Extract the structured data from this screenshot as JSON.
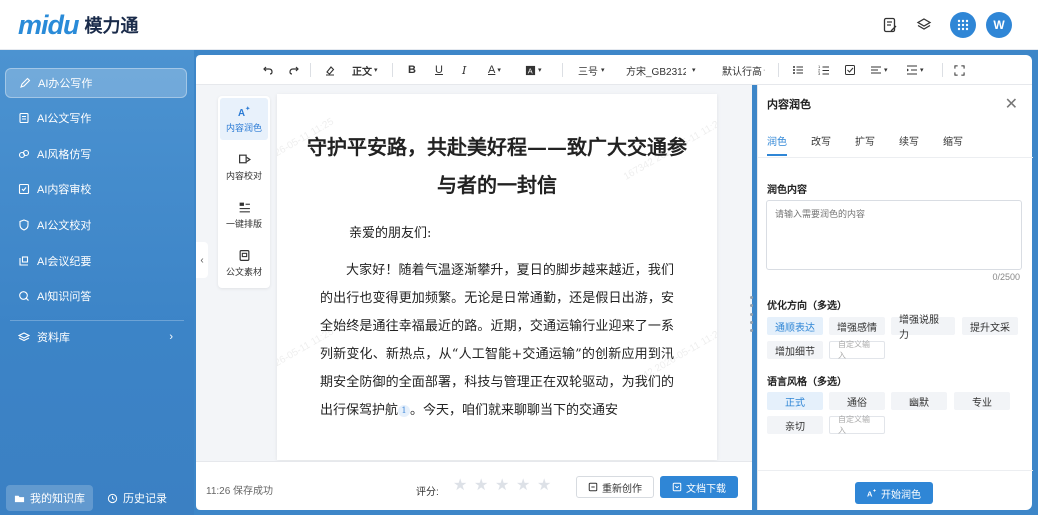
{
  "brand": {
    "logo_mark": "midu",
    "logo_text": "模力通"
  },
  "header": {
    "icons": [
      "document-edit-icon",
      "layers-icon",
      "apps-grid-icon"
    ],
    "avatar_initial": "W"
  },
  "sidebar": {
    "items": [
      {
        "label": "AI办公写作",
        "icon": "pen-icon",
        "active": true
      },
      {
        "label": "AI公文写作",
        "icon": "document-icon",
        "active": false
      },
      {
        "label": "AI风格仿写",
        "icon": "style-icon",
        "active": false
      },
      {
        "label": "AI内容审校",
        "icon": "review-icon",
        "active": false
      },
      {
        "label": "AI公文校对",
        "icon": "shield-check-icon",
        "active": false
      },
      {
        "label": "AI会议纪要",
        "icon": "meeting-icon",
        "active": false
      },
      {
        "label": "AI知识问答",
        "icon": "qa-icon",
        "active": false
      }
    ],
    "library": {
      "label": "资料库",
      "icon": "library-icon"
    },
    "bottom": {
      "knowledge_base": "我的知识库",
      "history": "历史记录"
    }
  },
  "toolbar": {
    "paragraph_style": "正文",
    "font_size": "三号",
    "font_family": "方宋_GB2312",
    "line_height": "默认行高"
  },
  "tools": [
    {
      "label": "内容润色",
      "icon": "ai-polish-icon",
      "active": true
    },
    {
      "label": "内容校对",
      "icon": "proofread-icon",
      "active": false
    },
    {
      "label": "一键排版",
      "icon": "layout-icon",
      "active": false
    },
    {
      "label": "公文素材",
      "icon": "material-icon",
      "active": false
    }
  ],
  "document": {
    "title": "守护平安路，共赴美好程——致广大交通参与者的一封信",
    "greeting": "亲爱的朋友们:",
    "body_before_cite": "大家好！随着气温逐渐攀升，夏日的脚步越来越近，我们的出行也变得更加频繁。无论是日常通勤，还是假日出游，安全始终是通往幸福最近的路。近期，交通运输行业迎来了一系列新变化、新热点，从“人工智能+交通运输”的创新应用到汛期安全防御的全面部署，科技与管理正在双轮驱动，为我们的出行保驾护航",
    "cite_number": "1",
    "body_after_cite": "。今天，咱们就来聊聊当下的交通安",
    "watermark_id": "167342",
    "watermark_date": "2026-05-11 11:25"
  },
  "footer": {
    "save_status": "11:26 保存成功",
    "rating_label": "评分:",
    "rating": 0,
    "rating_max": 5,
    "recreate_label": "重新创作",
    "download_label": "文档下载"
  },
  "right_panel": {
    "title": "内容润色",
    "tabs": [
      "润色",
      "改写",
      "扩写",
      "续写",
      "缩写"
    ],
    "active_tab": 0,
    "content_label": "润色内容",
    "content_placeholder": "请输入需要润色的内容",
    "char_count": "0/2500",
    "direction_label": "优化方向（多选）",
    "directions": [
      "通顺表达",
      "增强感情",
      "增强说服力",
      "提升文采",
      "增加细节"
    ],
    "style_label": "语言风格（多选）",
    "styles": [
      "正式",
      "通俗",
      "幽默",
      "专业",
      "亲切"
    ],
    "custom_placeholder": "自定义输入",
    "start_label": "开始润色"
  },
  "colors": {
    "accent": "#2f86d6",
    "sidebar": "#3d86c8"
  }
}
